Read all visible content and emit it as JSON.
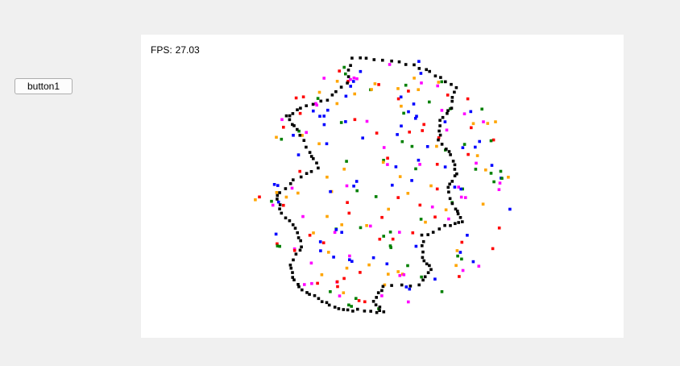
{
  "controls": {
    "button1_label": "button1"
  },
  "stats": {
    "fps_label": "FPS:",
    "fps_value": "27.03"
  },
  "colors": {
    "window_bg": "#f0f0f0",
    "canvas_bg": "#ffffff",
    "particles": [
      "#000000",
      "#ff0000",
      "#ff00ff",
      "#0000ff",
      "#008000",
      "#ffa500"
    ]
  }
}
